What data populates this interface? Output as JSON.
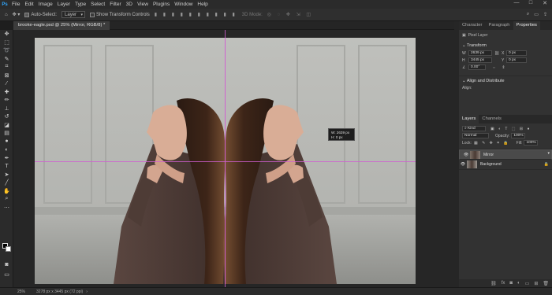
{
  "menu": {
    "items": [
      "File",
      "Edit",
      "Image",
      "Layer",
      "Type",
      "Select",
      "Filter",
      "3D",
      "View",
      "Plugins",
      "Window",
      "Help"
    ],
    "window_controls": {
      "minimize": "—",
      "maximize": "□",
      "close": "✕"
    }
  },
  "options": {
    "auto_select_label": "Auto-Select:",
    "auto_select_target": "Layer",
    "show_transform_label": "Show Transform Controls",
    "mode_3d_label": "3D Mode:"
  },
  "document": {
    "tab_title": "brooke-eagle.psd @ 25% (Mirror, RGB/8) *"
  },
  "tooltip": {
    "w": "W: 2639 px",
    "h": "H: 0 px"
  },
  "status": {
    "zoom": "25%",
    "doc_info": "3278 px x 3445 px (72 ppi)"
  },
  "panel_tabs": [
    "Character",
    "Paragraph",
    "Properties"
  ],
  "properties": {
    "kind": "Pixel Layer",
    "transform_title": "Transform",
    "w_label": "W",
    "w_value": "2639 px",
    "x_label": "X",
    "x_value": "0 px",
    "h_label": "H",
    "h_value": "3445 px",
    "y_label": "Y",
    "y_value": "0 px",
    "angle_value": "0.00°",
    "align_title": "Align and Distribute",
    "align_label": "Align:"
  },
  "layers_panel": {
    "tabs": [
      "Layers",
      "Channels"
    ],
    "kind_label": "Kind",
    "blend_mode": "Normal",
    "opacity_label": "Opacity:",
    "opacity_value": "100%",
    "lock_label": "Lock:",
    "fill_label": "Fill:",
    "fill_value": "100%",
    "layers": [
      {
        "name": "Mirror",
        "selected": true
      },
      {
        "name": "Background",
        "selected": false
      }
    ]
  }
}
